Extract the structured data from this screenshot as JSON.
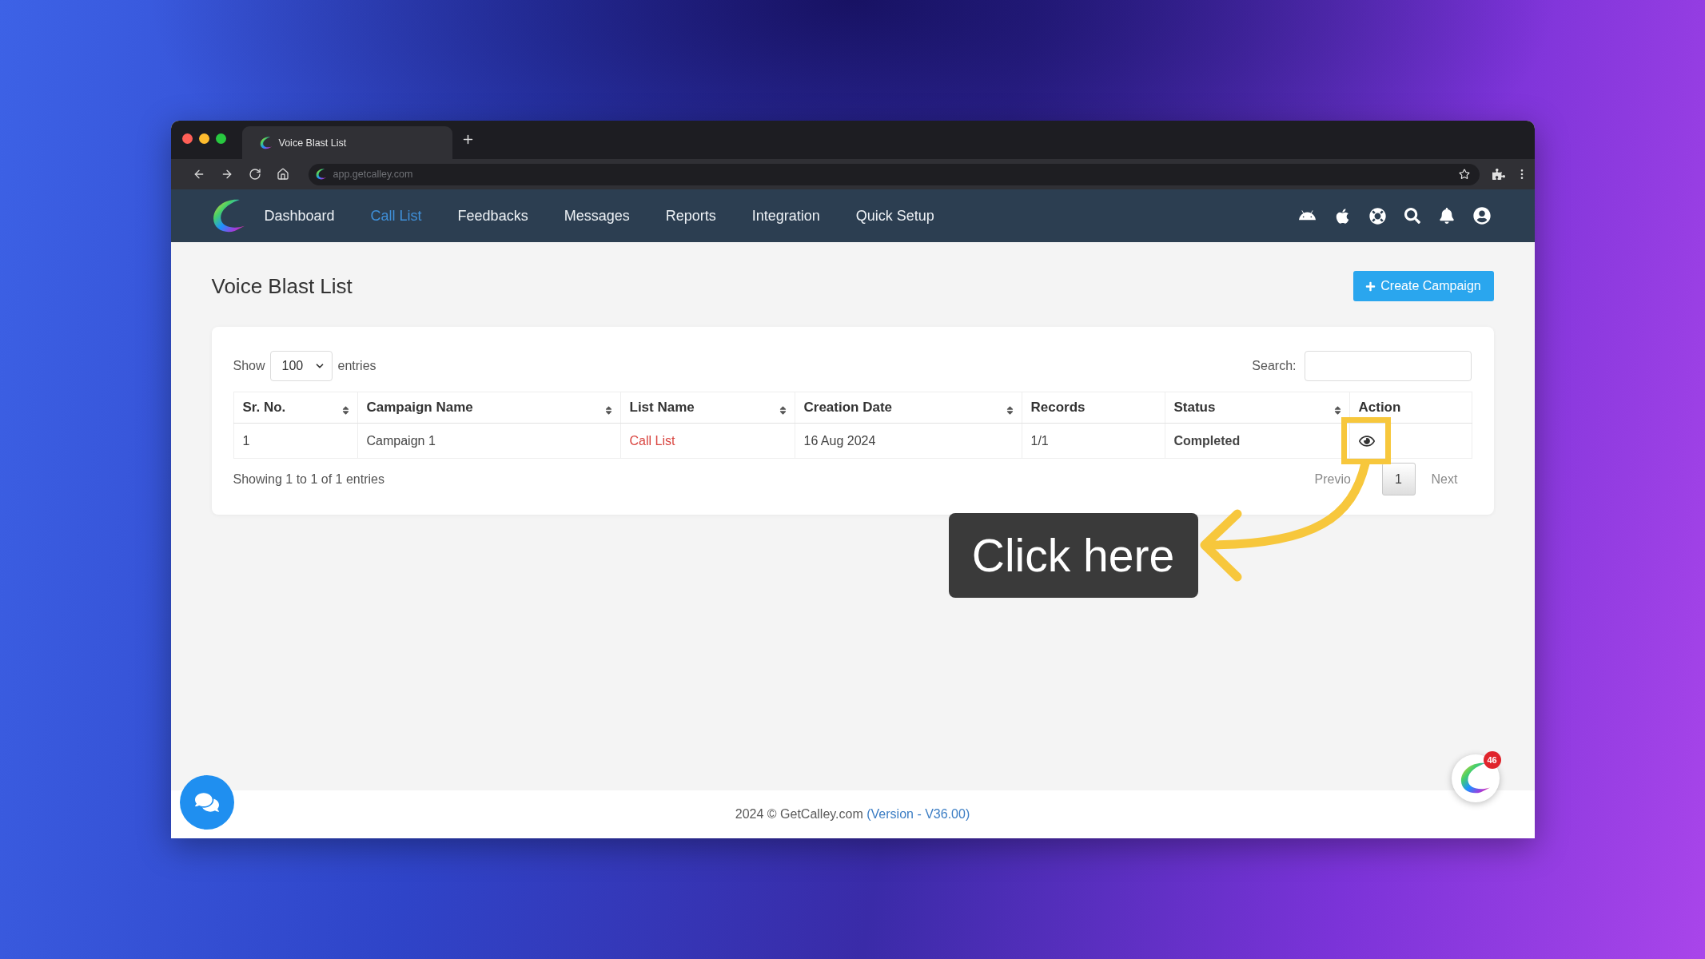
{
  "browser": {
    "tab": {
      "title": "Voice Blast List"
    },
    "address": {
      "value": "app.getcalley.com"
    }
  },
  "navbar": {
    "items": [
      {
        "label": "Dashboard",
        "selected": false
      },
      {
        "label": "Call List",
        "selected": true
      },
      {
        "label": "Feedbacks",
        "selected": false
      },
      {
        "label": "Messages",
        "selected": false
      },
      {
        "label": "Reports",
        "selected": false
      },
      {
        "label": "Integration",
        "selected": false
      },
      {
        "label": "Quick Setup",
        "selected": false
      }
    ]
  },
  "page": {
    "title": "Voice Blast List",
    "create_button": "Create Campaign"
  },
  "table_controls": {
    "show_label": "Show",
    "page_size": "100",
    "entries_label": "entries",
    "search_label": "Search:"
  },
  "table": {
    "columns": [
      {
        "label": "Sr. No.",
        "sortable": true
      },
      {
        "label": "Campaign Name",
        "sortable": true
      },
      {
        "label": "List Name",
        "sortable": true
      },
      {
        "label": "Creation Date",
        "sortable": true
      },
      {
        "label": "Records",
        "sortable": false
      },
      {
        "label": "Status",
        "sortable": true
      },
      {
        "label": "Action",
        "sortable": false
      }
    ],
    "rows": [
      {
        "cells": [
          {
            "kind": "text",
            "text": "1"
          },
          {
            "kind": "text",
            "text": "Campaign 1"
          },
          {
            "kind": "link",
            "text": "Call List"
          },
          {
            "kind": "text",
            "text": "16 Aug 2024"
          },
          {
            "kind": "text",
            "text": "1/1"
          },
          {
            "kind": "strong",
            "text": "Completed"
          },
          {
            "kind": "view_action",
            "highlighted": true
          }
        ]
      }
    ]
  },
  "table_info": "Showing 1 to 1 of 1 entries",
  "pagination": {
    "previous": "Previo",
    "pages": [
      {
        "label": "1",
        "selected": true
      }
    ],
    "next": "Next"
  },
  "annotation": {
    "callout": "Click here"
  },
  "footer": {
    "copyright": "2024 © GetCalley.com",
    "version_link": "(Version - V36.00)"
  },
  "widget": {
    "badge": "46"
  }
}
